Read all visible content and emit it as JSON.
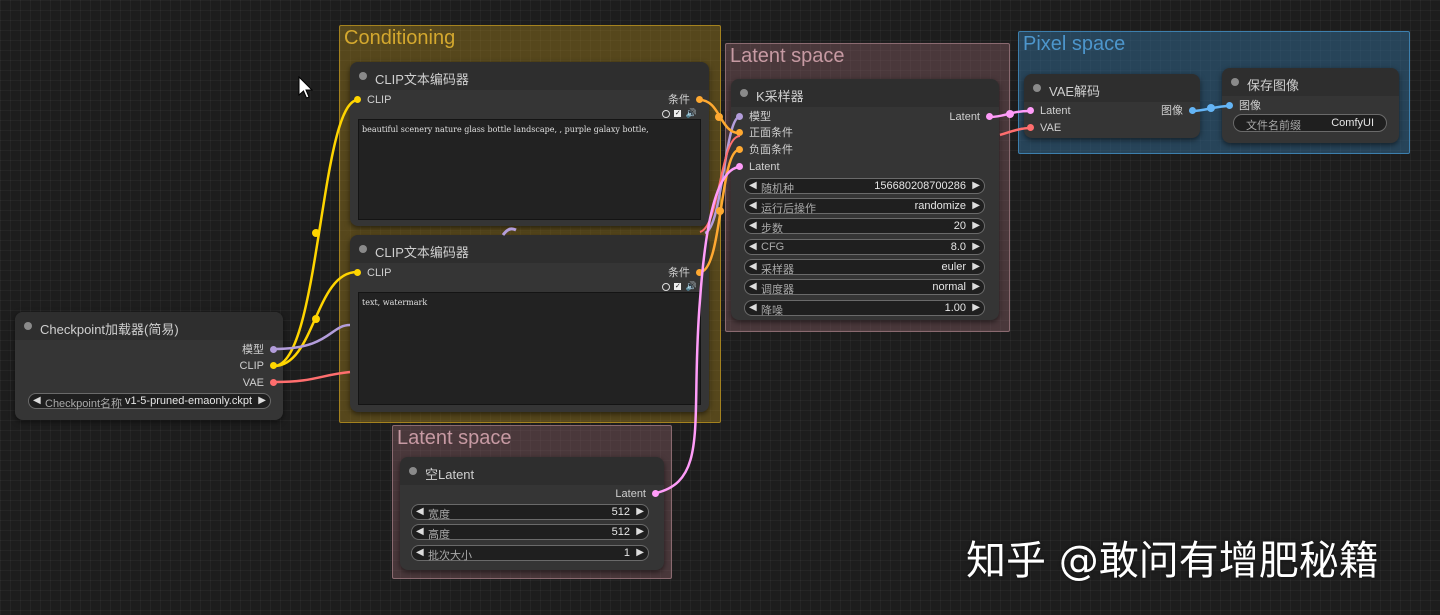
{
  "groups": {
    "conditioning": {
      "title": "Conditioning",
      "color": "#c8a12a"
    },
    "latent_top": {
      "title": "Latent space",
      "color": "#b58b92"
    },
    "pixel": {
      "title": "Pixel space",
      "color": "#3f86b8"
    },
    "latent_bottom": {
      "title": "Latent space",
      "color": "#b58b92"
    }
  },
  "slot_colors": {
    "model": "#b39ddb",
    "clip": "#ffd500",
    "vae": "#ff6e6e",
    "cond": "#ffa931",
    "latent": "#ff9cf9",
    "image": "#64b5f6"
  },
  "clip_pos": {
    "title": "CLIP文本编码器",
    "in_clip": "CLIP",
    "out_cond": "条件",
    "text": "beautiful scenery nature glass bottle landscape, , purple galaxy bottle,",
    "check": "✓",
    "icon": "speaker-icon"
  },
  "clip_neg": {
    "title": "CLIP文本编码器",
    "in_clip": "CLIP",
    "out_cond": "条件",
    "text": "text, watermark",
    "check": "✓",
    "icon": "speaker-icon"
  },
  "checkpoint": {
    "title": "Checkpoint加载器(简易)",
    "out_model": "模型",
    "out_clip": "CLIP",
    "out_vae": "VAE",
    "ckpt_label": "Checkpoint名称",
    "ckpt_value": "v1-5-pruned-emaonly.ckpt"
  },
  "ksampler": {
    "title": "K采样器",
    "in_model": "模型",
    "in_pos": "正面条件",
    "in_neg": "负面条件",
    "in_latent": "Latent",
    "out_latent": "Latent",
    "widgets": [
      {
        "label": "随机种",
        "value": "156680208700286"
      },
      {
        "label": "运行后操作",
        "value": "randomize"
      },
      {
        "label": "步数",
        "value": "20"
      },
      {
        "label": "CFG",
        "value": "8.0"
      },
      {
        "label": "采样器",
        "value": "euler"
      },
      {
        "label": "调度器",
        "value": "normal"
      },
      {
        "label": "降噪",
        "value": "1.00"
      }
    ]
  },
  "vae_decode": {
    "title": "VAE解码",
    "in_latent": "Latent",
    "in_vae": "VAE",
    "out_image": "图像"
  },
  "save_image": {
    "title": "保存图像",
    "in_image": "图像",
    "prefix_label": "文件名前缀",
    "prefix_value": "ComfyUI"
  },
  "empty_latent": {
    "title": "空Latent",
    "out_latent": "Latent",
    "widgets": [
      {
        "label": "宽度",
        "value": "512"
      },
      {
        "label": "高度",
        "value": "512"
      },
      {
        "label": "批次大小",
        "value": "1"
      }
    ]
  },
  "watermark": "知乎 @敢问有增肥秘籍"
}
